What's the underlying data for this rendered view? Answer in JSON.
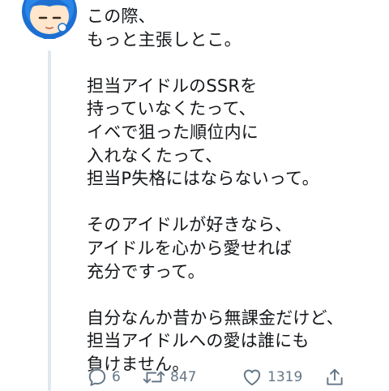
{
  "tweet": {
    "lines": [
      "この際、",
      "もっと主張しとこ。",
      "",
      "担当アイドルのSSRを",
      "持っていなくたって、",
      "イベで狙った順位内に",
      "入れなくたって、",
      "担当P失格にはならないって。",
      "",
      "そのアイドルが好きなら、",
      "アイドルを心から愛せれば",
      "充分ですって。",
      "",
      "自分なんか昔から無課金だけど、",
      "担当アイドルへの愛は誰にも",
      "負けません。"
    ]
  },
  "actions": {
    "reply_count": "6",
    "retweet_count": "847",
    "like_count": "1319"
  },
  "icons": {
    "avatar": "character-avatar",
    "reply": "reply-icon",
    "retweet": "retweet-icon",
    "like": "heart-icon",
    "share": "share-icon"
  },
  "colors": {
    "text": "#14171a",
    "icon": "#657786",
    "thread_line": "#e1e8ed"
  }
}
